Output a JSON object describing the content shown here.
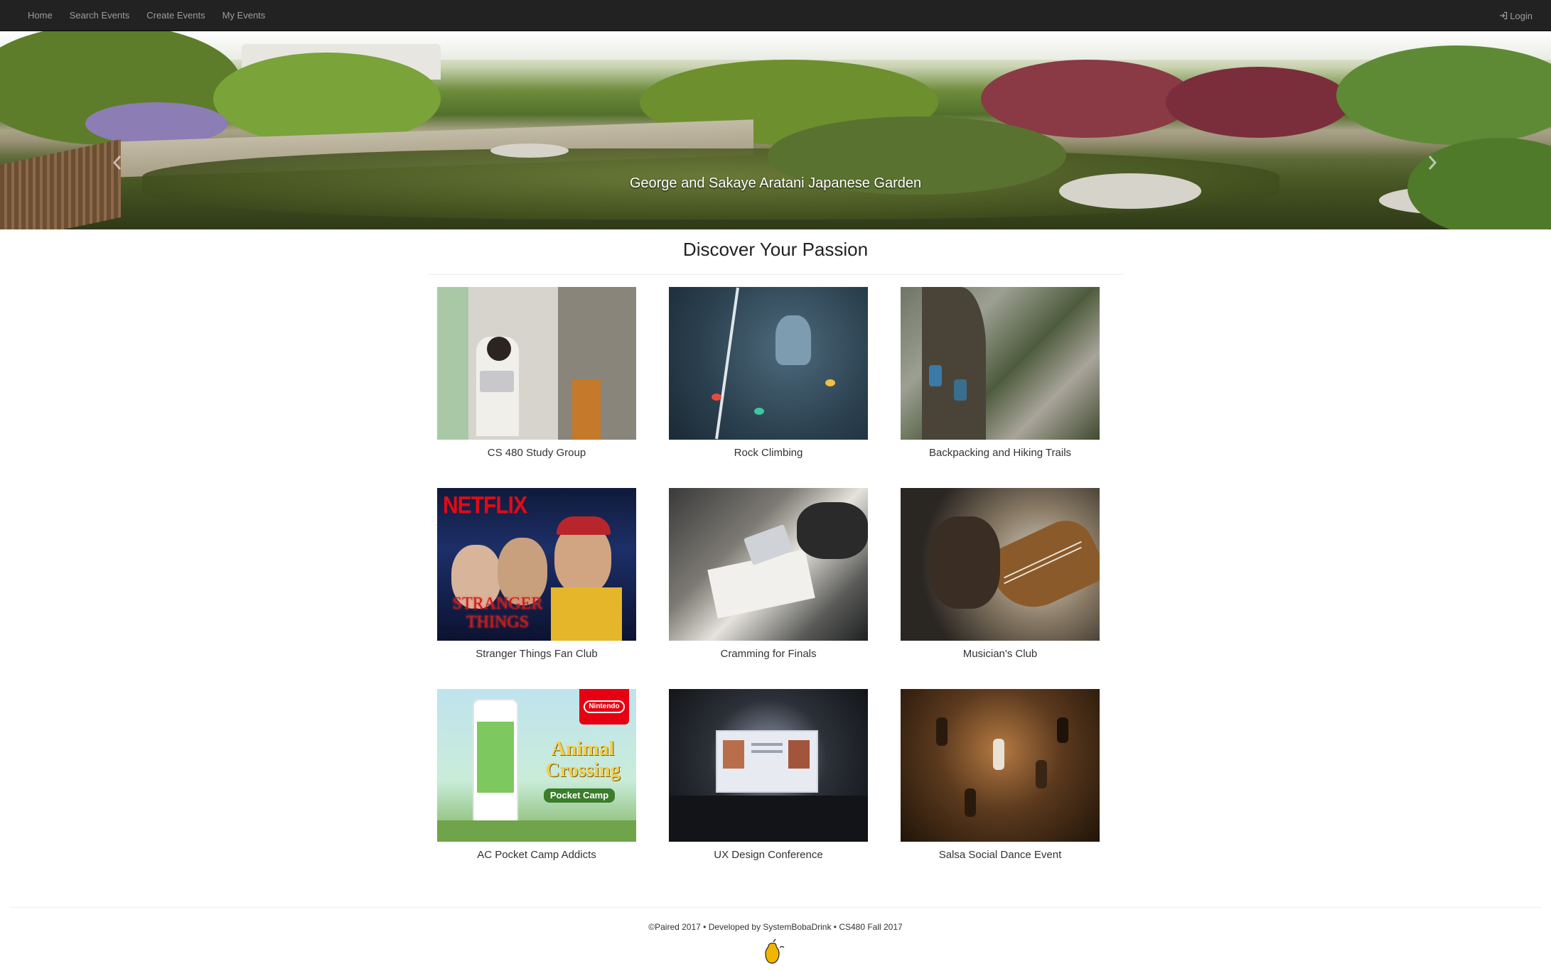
{
  "nav": {
    "links": [
      "Home",
      "Search Events",
      "Create Events",
      "My Events"
    ],
    "login": "Login"
  },
  "carousel": {
    "caption": "George and Sakaye Aratani Japanese Garden"
  },
  "section": {
    "title": "Discover Your Passion"
  },
  "events": [
    {
      "label": "CS 480 Study Group"
    },
    {
      "label": "Rock Climbing"
    },
    {
      "label": "Backpacking and Hiking Trails"
    },
    {
      "label": "Stranger Things Fan Club"
    },
    {
      "label": "Cramming for Finals"
    },
    {
      "label": "Musician's Club"
    },
    {
      "label": "AC Pocket Camp Addicts"
    },
    {
      "label": "UX Design Conference"
    },
    {
      "label": "Salsa Social Dance Event"
    }
  ],
  "thumb_text": {
    "netflix": "NETFLIX",
    "stranger_things": "STRANGER THINGS",
    "nintendo": "Nintendo",
    "animal_crossing": "Animal Crossing",
    "pocket_camp": "Pocket Camp"
  },
  "footer": {
    "text": "©Paired 2017 • Developed by SystemBobaDrink • CS480 Fall 2017"
  },
  "colors": {
    "navbar": "#222222",
    "nav_text": "#9d9d9d",
    "netflix_red": "#e50914",
    "nintendo_red": "#e60012"
  }
}
